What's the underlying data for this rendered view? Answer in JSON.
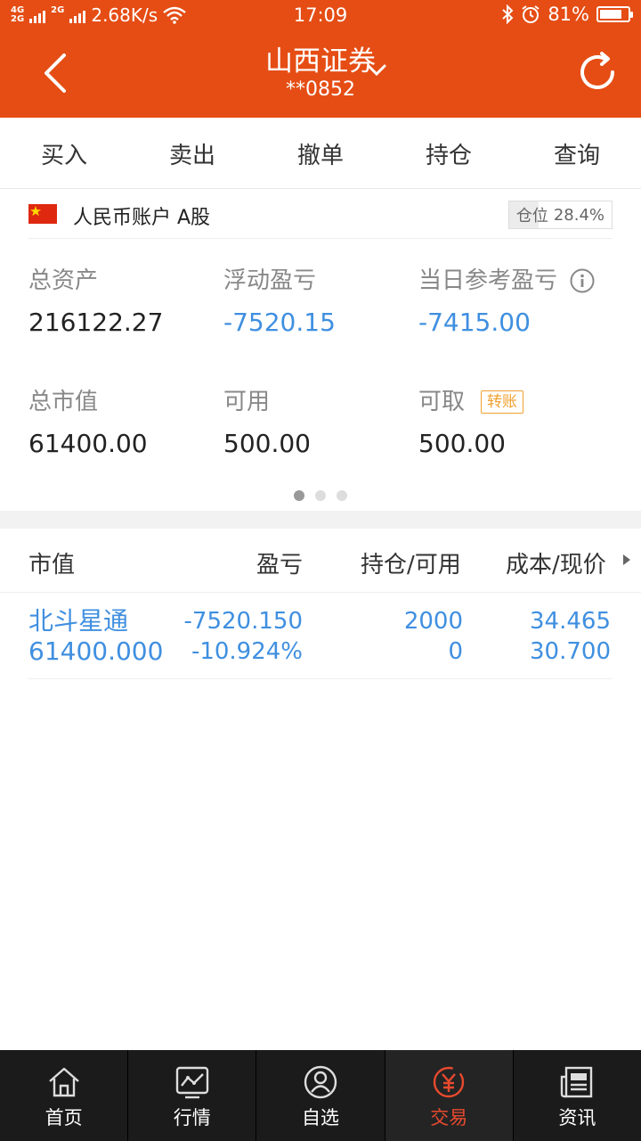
{
  "status_bar": {
    "network_top": "4G",
    "network_bottom": "2G",
    "network2": "2G",
    "speed": "2.68K/s",
    "time": "17:09",
    "battery": "81%",
    "battery_level": 0.81
  },
  "nav": {
    "title": "山西证券",
    "account": "**0852"
  },
  "tabs": [
    "买入",
    "卖出",
    "撤单",
    "持仓",
    "查询"
  ],
  "active_tab": 3,
  "account": {
    "name": "人民币账户 A股",
    "position_label": "仓位",
    "position_value": "28.4%"
  },
  "summary": {
    "total_assets_label": "总资产",
    "total_assets": "216122.27",
    "floating_pl_label": "浮动盈亏",
    "floating_pl": "-7520.15",
    "daily_pl_label": "当日参考盈亏",
    "daily_pl": "-7415.00",
    "market_value_label": "总市值",
    "market_value": "61400.00",
    "available_label": "可用",
    "available": "500.00",
    "withdrawable_label": "可取",
    "withdrawable": "500.00",
    "transfer_label": "转账"
  },
  "table": {
    "headers": [
      "市值",
      "盈亏",
      "持仓/可用",
      "成本/现价"
    ],
    "rows": [
      {
        "name": "北斗星通",
        "market_value": "61400.000",
        "pl": "-7520.150",
        "pl_pct": "-10.924%",
        "holding": "2000",
        "available": "0",
        "cost": "34.465",
        "price": "30.700"
      }
    ]
  },
  "bottom_nav": [
    {
      "label": "首页",
      "icon": "home-icon"
    },
    {
      "label": "行情",
      "icon": "market-chart-icon"
    },
    {
      "label": "自选",
      "icon": "watchlist-icon"
    },
    {
      "label": "交易",
      "icon": "trade-yuan-icon"
    },
    {
      "label": "资讯",
      "icon": "news-icon"
    }
  ],
  "bottom_active": 3,
  "colors": {
    "brand": "#e54d14",
    "active_tab": "#e8382e",
    "value_blue": "#3f8fe0",
    "transfer": "#f0a030"
  }
}
